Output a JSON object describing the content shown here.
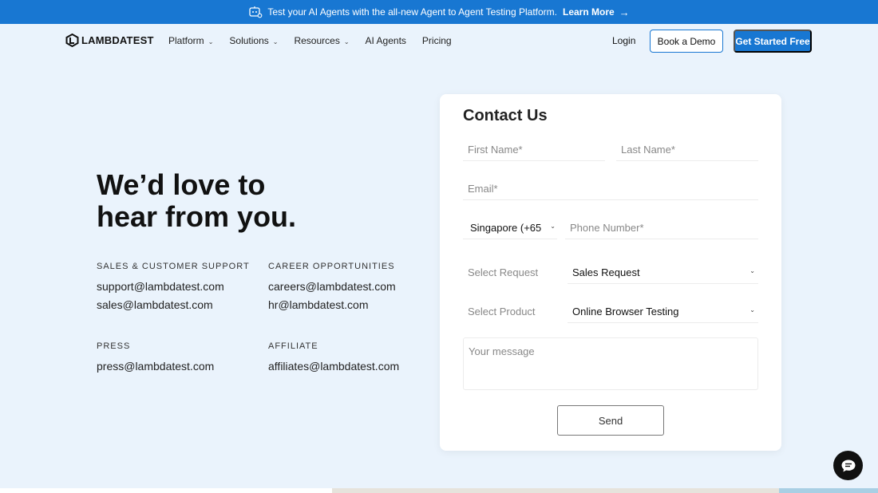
{
  "banner": {
    "text": "Test your AI Agents with the all-new Agent to Agent Testing Platform.",
    "link": "Learn More",
    "icon": "agent-test-icon"
  },
  "nav": {
    "logo": "LAMBDATEST",
    "items": [
      {
        "label": "Platform",
        "dropdown": true
      },
      {
        "label": "Solutions",
        "dropdown": true
      },
      {
        "label": "Resources",
        "dropdown": true
      },
      {
        "label": "AI Agents",
        "dropdown": false
      },
      {
        "label": "Pricing",
        "dropdown": false
      }
    ],
    "login": "Login",
    "demo": "Book a Demo",
    "start": "Get Started Free"
  },
  "hero": {
    "line1": "We’d love to",
    "line2": "hear from you."
  },
  "contacts": {
    "support": {
      "heading": "SALES & CUSTOMER SUPPORT",
      "lines": [
        "support@lambdatest.com",
        "sales@lambdatest.com"
      ]
    },
    "career": {
      "heading": "CAREER OPPORTUNITIES",
      "lines": [
        "careers@lambdatest.com",
        "hr@lambdatest.com"
      ]
    },
    "press": {
      "heading": "PRESS",
      "lines": [
        "press@lambdatest.com"
      ]
    },
    "affiliate": {
      "heading": "AFFILIATE",
      "lines": [
        "affiliates@lambdatest.com"
      ]
    }
  },
  "form": {
    "title": "Contact Us",
    "first_name_placeholder": "First Name*",
    "last_name_placeholder": "Last Name*",
    "email_placeholder": "Email*",
    "country_code": "Singapore (+65",
    "phone_placeholder": "Phone Number*",
    "request_label": "Select Request",
    "request_value": "Sales Request",
    "product_label": "Select Product",
    "product_value": "Online Browser Testing",
    "message_placeholder": "Your message",
    "send": "Send"
  },
  "colors": {
    "brand": "#1877d2",
    "page_bg": "#eaf3fc"
  }
}
